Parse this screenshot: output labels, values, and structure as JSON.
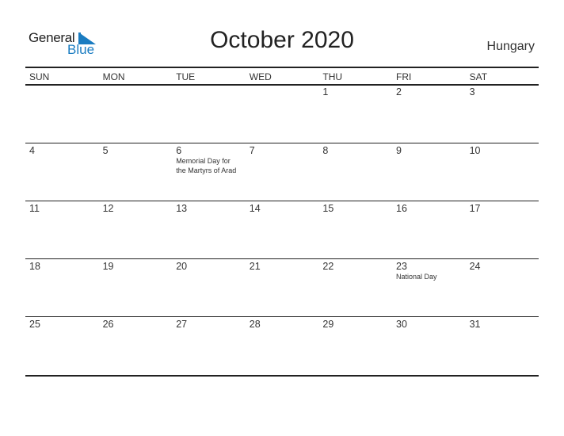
{
  "logo": {
    "word1": "General",
    "word2": "Blue",
    "accent": "#1a7cc1"
  },
  "header": {
    "title": "October 2020",
    "country": "Hungary"
  },
  "weekdays": [
    "SUN",
    "MON",
    "TUE",
    "WED",
    "THU",
    "FRI",
    "SAT"
  ],
  "weeks": [
    [
      null,
      null,
      null,
      null,
      "1",
      "2",
      "3"
    ],
    [
      "4",
      "5",
      "6",
      "7",
      "8",
      "9",
      "10"
    ],
    [
      "11",
      "12",
      "13",
      "14",
      "15",
      "16",
      "17"
    ],
    [
      "18",
      "19",
      "20",
      "21",
      "22",
      "23",
      "24"
    ],
    [
      "25",
      "26",
      "27",
      "28",
      "29",
      "30",
      "31"
    ]
  ],
  "events": [
    {
      "week": 1,
      "col": 2,
      "lines": [
        "Memorial Day for",
        "the Martyrs of Arad"
      ]
    },
    {
      "week": 3,
      "col": 5,
      "lines": [
        "National Day"
      ]
    }
  ]
}
